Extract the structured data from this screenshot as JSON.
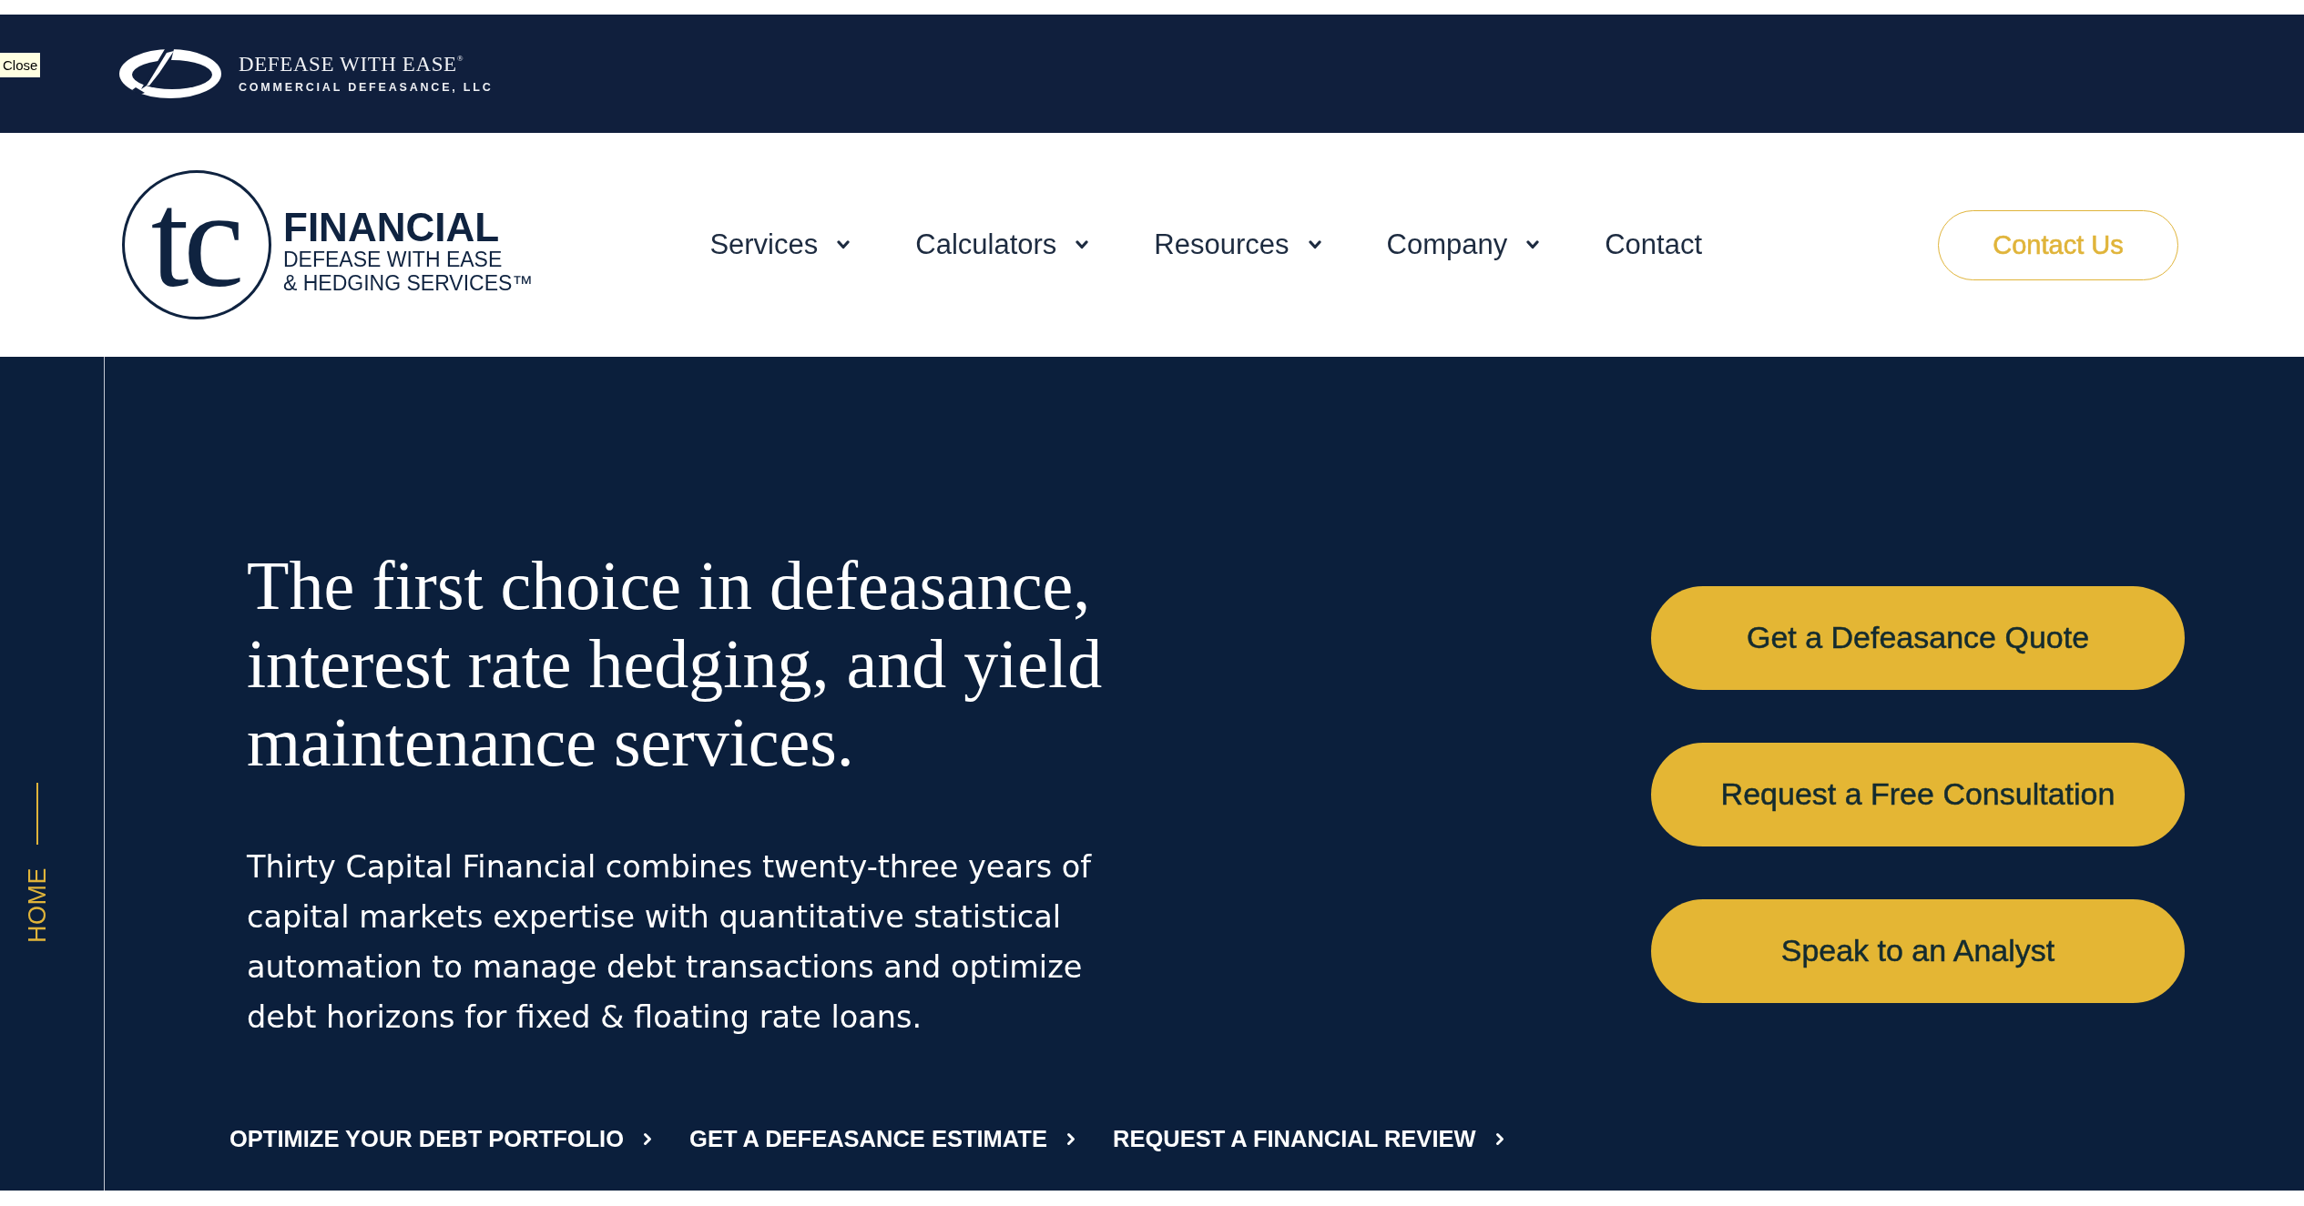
{
  "top_bar": {
    "close_tooltip": "Close",
    "brand_name": "DEFEASE WITH EASE$^{®}$",
    "brand_tagline": "COMMERCIAL DEFEASANCE, LLC"
  },
  "header": {
    "logo": {
      "monogram": "tc",
      "title": "FINANCIAL",
      "subtitle_lines": [
        "DEFEASE WITH EASE",
        "& HEDGING SERVICES™"
      ]
    },
    "nav": [
      {
        "label": "Services",
        "has_menu": true
      },
      {
        "label": "Calculators",
        "has_menu": true
      },
      {
        "label": "Resources",
        "has_menu": true
      },
      {
        "label": "Company",
        "has_menu": true
      },
      {
        "label": "Contact",
        "has_menu": false
      }
    ],
    "contact_button": "Contact Us"
  },
  "hero": {
    "side_label": "HOME",
    "heading": "The first choice in defeasance, interest rate hedging, and yield maintenance services.",
    "body": "Thirty Capital Financial combines twenty-three years of capital markets expertise with quantitative statistical automation to manage debt transactions and optimize debt horizons for fixed & floating rate loans.",
    "buttons": [
      "Get a Defeasance Quote",
      "Request a Free Consultation",
      "Speak to an Analyst"
    ],
    "links": [
      "OPTIMIZE YOUR DEBT PORTFOLIO",
      "GET A DEFEASANCE ESTIMATE",
      "REQUEST A FINANCIAL REVIEW"
    ]
  }
}
